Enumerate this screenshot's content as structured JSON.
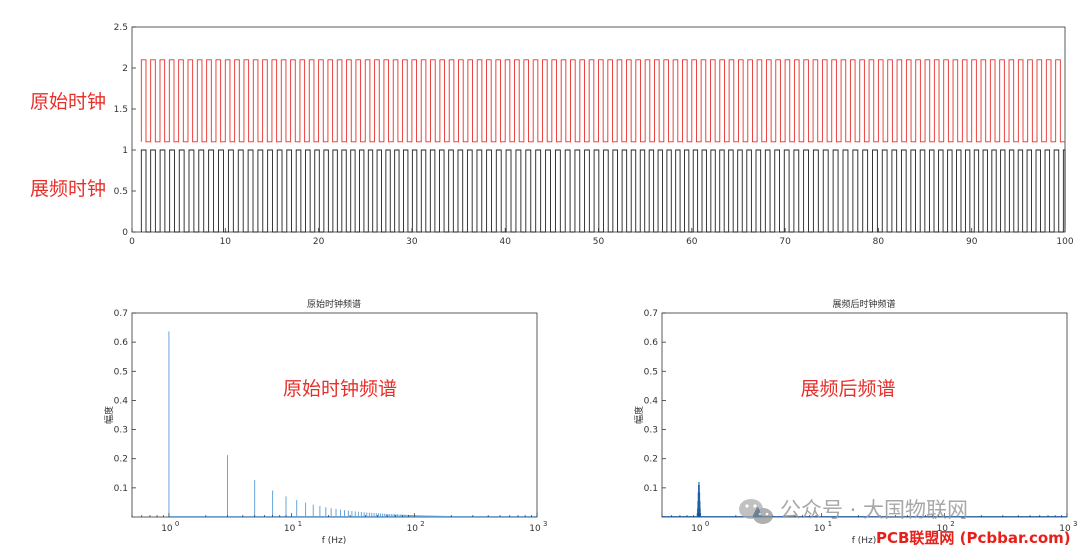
{
  "chart_data": [
    {
      "type": "line",
      "title": "",
      "xlabel": "",
      "ylabel": "",
      "xlim": [
        0,
        100
      ],
      "ylim": [
        0,
        2.5
      ],
      "xticks": [
        0,
        10,
        20,
        30,
        40,
        50,
        60,
        70,
        80,
        90,
        100
      ],
      "yticks": [
        0,
        0.5,
        1,
        1.5,
        2,
        2.5
      ],
      "xtick_labels": [
        "0",
        "10",
        "20",
        "30",
        "40",
        "50",
        "60",
        "70",
        "80",
        "90",
        "100"
      ],
      "ytick_labels": [
        "0",
        "0.5",
        "1",
        "1.5",
        "2",
        "2.5"
      ],
      "series": [
        {
          "waveform": "square",
          "color": "#e8302b",
          "low": 1.1,
          "high": 2.1,
          "period": 1.0,
          "start": 1.0,
          "end": 100
        },
        {
          "waveform": "square",
          "color": "#222222",
          "low": 0,
          "high": 1.0,
          "period_range": [
            0.94,
            1.06
          ],
          "start": 1.0,
          "end": 100
        }
      ],
      "annotations": [
        "原始时钟",
        "展频时钟"
      ],
      "grid": false
    },
    {
      "type": "bar",
      "title": "原始时钟频谱",
      "xlabel": "f (Hz)",
      "ylabel": "幅度",
      "xscale": "log",
      "xlim": [
        0.5,
        1000
      ],
      "ylim": [
        0,
        0.7
      ],
      "yticks": [
        0.1,
        0.2,
        0.3,
        0.4,
        0.5,
        0.6,
        0.7
      ],
      "ytick_labels": [
        "0.1",
        "0.2",
        "0.3",
        "0.4",
        "0.5",
        "0.6",
        "0.7"
      ],
      "xticks": [
        1,
        10,
        100,
        1000
      ],
      "xtick_bases": [
        "10",
        "10",
        "10",
        "10"
      ],
      "xtick_exps": [
        "0",
        "1",
        "2",
        "3"
      ],
      "color": "#5b9bd5",
      "harmonics": "odd",
      "fundamental": 1,
      "fundamental_amplitude": 0.637,
      "max_frequency": 200,
      "annotation": "原始时钟频谱"
    },
    {
      "type": "bar",
      "title": "展频后时钟频谱",
      "xlabel": "f (Hz)",
      "ylabel": "幅度",
      "xscale": "log",
      "xlim": [
        0.5,
        1000
      ],
      "ylim": [
        0,
        0.7
      ],
      "yticks": [
        0.1,
        0.2,
        0.3,
        0.4,
        0.5,
        0.6,
        0.7
      ],
      "ytick_labels": [
        "0.1",
        "0.2",
        "0.3",
        "0.4",
        "0.5",
        "0.6",
        "0.7"
      ],
      "xticks": [
        1,
        10,
        100,
        1000
      ],
      "xtick_bases": [
        "10",
        "10",
        "10",
        "10"
      ],
      "xtick_exps": [
        "0",
        "1",
        "2",
        "3"
      ],
      "color": "#1f5fa8",
      "peaks": [
        {
          "f": 1.0,
          "amplitude": 0.12,
          "spread": 0.06
        },
        {
          "f": 3.0,
          "amplitude": 0.035,
          "spread": 0.18
        }
      ],
      "annotation": "展频后频谱"
    }
  ],
  "watermark": {
    "text": "公众号 · 大国物联网",
    "brand": "PCB联盟网 (Pcbbar.com)",
    "icon": "wechat-icon"
  }
}
